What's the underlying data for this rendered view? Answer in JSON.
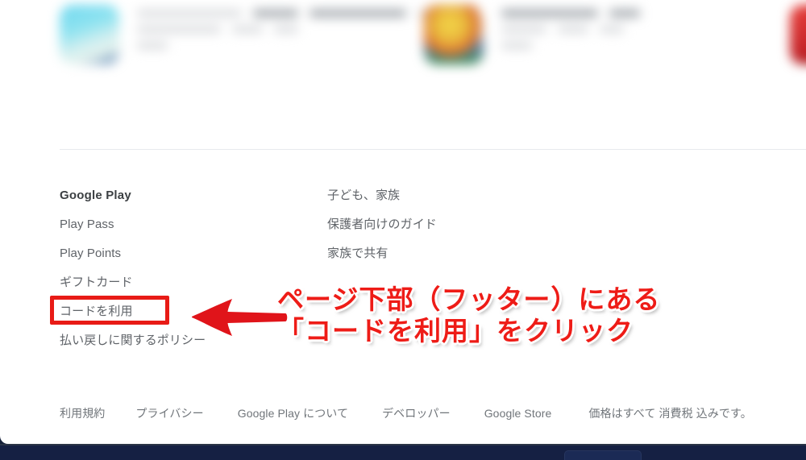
{
  "page": {
    "site": "Google Play",
    "language": "ja"
  },
  "results": {
    "note": "blurred app result cards",
    "cards": [
      {
        "icon": "app-icon-blue",
        "lines": 3
      },
      {
        "icon": "app-icon-colorful",
        "lines": 3
      },
      {
        "icon": "app-icon-red",
        "lines": 0
      }
    ]
  },
  "footer": {
    "columns": [
      {
        "name": "google-play",
        "items": [
          {
            "label": "Google Play",
            "heading": true
          },
          {
            "label": "Play Pass",
            "heading": false
          },
          {
            "label": "Play Points",
            "heading": false
          },
          {
            "label": "ギフトカード",
            "heading": false
          },
          {
            "label": "コードを利用",
            "heading": false,
            "highlighted": true
          },
          {
            "label": "払い戻しに関するポリシー",
            "heading": false
          }
        ]
      },
      {
        "name": "family",
        "items": [
          {
            "label": "子ども、家族",
            "heading": false
          },
          {
            "label": "保護者向けのガイド",
            "heading": false
          },
          {
            "label": "家族で共有",
            "heading": false
          }
        ]
      }
    ],
    "legal": [
      "利用規約",
      "プライバシー",
      "Google Play について",
      "デベロッパー",
      "Google Store"
    ],
    "tax_notice": "価格はすべて 消費税 込みです。"
  },
  "annotation": {
    "line1": "ページ下部（フッター）にある",
    "line2": "「コードを利用」をクリック",
    "arrow": "left-arrow",
    "color": "#ee1c17",
    "box_color": "#e81b16"
  },
  "taskbar": {
    "background": "#152043",
    "button_label": ""
  }
}
